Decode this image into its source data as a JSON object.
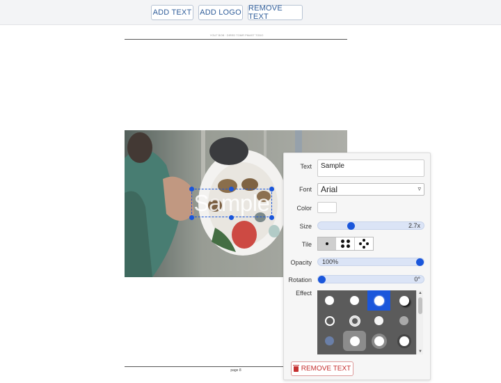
{
  "toolbar": {
    "add_text": "ADD TEXT",
    "add_logo": "ADD LOGO",
    "remove_text": "REMOVE TEXT"
  },
  "page": {
    "header": "YOUT BOB · DIRED TOMR PMAST TODO",
    "footer": "page 8"
  },
  "watermark": {
    "text": "Sample"
  },
  "panel": {
    "text_label": "Text",
    "text_value": "Sample",
    "font_label": "Font",
    "font_value": "Arial",
    "color_label": "Color",
    "color_value": "#ffffff",
    "size_label": "Size",
    "size_value": "2.7x",
    "size_fraction": 0.3,
    "tile_label": "Tile",
    "tile_options": [
      "single",
      "four",
      "five"
    ],
    "tile_selected": "single",
    "opacity_label": "Opacity",
    "opacity_value": "100%",
    "opacity_fraction": 1.0,
    "rotation_label": "Rotation",
    "rotation_value": "0°",
    "rotation_fraction": 0.0,
    "effect_label": "Effect",
    "remove_label": "REMOVE TEXT"
  },
  "colors": {
    "accent": "#1a56db",
    "danger": "#c53030"
  }
}
